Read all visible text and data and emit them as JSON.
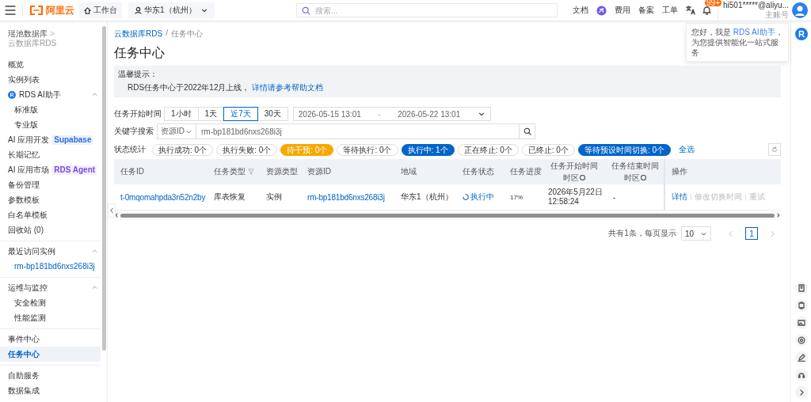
{
  "topbar": {
    "logo": "阿里云",
    "workbench": "工作台",
    "region": "华东1（杭州）",
    "search": {
      "placeholder": "搜索..."
    },
    "items": [
      {
        "kind": "text",
        "label": "文档"
      },
      {
        "kind": "spark"
      },
      {
        "kind": "text",
        "label": "费用"
      },
      {
        "kind": "text",
        "label": "备案"
      },
      {
        "kind": "text",
        "label": "工单"
      },
      {
        "kind": "translate"
      }
    ],
    "notification_badge": "99+",
    "account": {
      "email": "hi501*****@aliyu...",
      "role": "主账号"
    }
  },
  "ai_tip": {
    "prefix": "您好，我是 ",
    "link": "RDS AI助手",
    "suffix": "，为您提供智能化一站式服务"
  },
  "sidebar": {
    "breadcrumb": [
      "瑶池数据库",
      "云数据库RDS"
    ],
    "breadcrumb_separator": ">",
    "sections": [
      {
        "items": [
          {
            "label": "概览",
            "selected": false
          },
          {
            "label": "实例列表",
            "selected": false
          },
          {
            "label": "RDS AI助手",
            "selected": false,
            "kind": "ai",
            "expanded": true,
            "children": [
              {
                "label": "标准版",
                "selected": false
              },
              {
                "label": "专业版",
                "selected": false
              }
            ]
          },
          {
            "label": "AI 应用开发",
            "selected": false,
            "tag": {
              "label": "Supabase",
              "color": "#2f6fe4"
            }
          },
          {
            "label": "长期记忆",
            "selected": false
          },
          {
            "label": "AI 应用市场",
            "selected": false,
            "tag": {
              "label": "RDS Agent",
              "color": "#7a4ce0"
            }
          },
          {
            "label": "备份管理",
            "selected": false
          },
          {
            "label": "参数模板",
            "selected": false
          },
          {
            "label": "白名单模板",
            "selected": false
          },
          {
            "label": "回收站 (0)",
            "selected": false
          }
        ]
      },
      {
        "items": [
          {
            "label": "最近访问实例",
            "selected": false,
            "expanded": true,
            "children": [
              {
                "label": "rm-bp181bd6nxs268i3j",
                "selected": false,
                "kind": "link"
              }
            ]
          }
        ]
      },
      {
        "items": [
          {
            "label": "运维与监控",
            "selected": false,
            "expanded": true,
            "children": [
              {
                "label": "安全检测",
                "selected": false
              },
              {
                "label": "性能监测",
                "selected": false
              }
            ]
          }
        ]
      },
      {
        "items": [
          {
            "label": "事件中心",
            "selected": false
          },
          {
            "label": "任务中心",
            "selected": true
          }
        ]
      },
      {
        "items": [
          {
            "label": "自助服务",
            "selected": false
          },
          {
            "label": "数据集成",
            "selected": false
          }
        ]
      }
    ]
  },
  "main": {
    "breadcrumb": [
      "云数据库RDS",
      "任务中心"
    ],
    "breadcrumb_separator": "/",
    "title": "任务中心",
    "notice": {
      "title": "温馨提示：",
      "text": "RDS任务中心于2022年12月上线，",
      "link": "详情请参考帮助文档"
    },
    "time_filter": {
      "label": "任务开始时间",
      "ranges": [
        {
          "label": "1小时",
          "selected": false
        },
        {
          "label": "1天",
          "selected": false
        },
        {
          "label": "近7天",
          "selected": true
        },
        {
          "label": "30天",
          "selected": false
        }
      ],
      "date_start": "2026-05-15 13:01",
      "date_separator": "-",
      "date_end": "2026-05-22 13:01"
    },
    "keyword": {
      "label": "关键字搜索",
      "field_select": "资源ID",
      "value": "rm-bp181bd6nxs268i3j"
    },
    "status": {
      "label": "状态统计",
      "chips": [
        {
          "label": "执行成功: 0个",
          "kind": "plain"
        },
        {
          "label": "执行失败: 0个",
          "kind": "plain"
        },
        {
          "label": "待干预: 0个",
          "kind": "warning"
        },
        {
          "label": "等待执行: 0个",
          "kind": "plain"
        },
        {
          "label": "执行中: 1个",
          "kind": "primary"
        },
        {
          "label": "正在终止: 0个",
          "kind": "plain"
        },
        {
          "label": "已终止: 0个",
          "kind": "plain"
        },
        {
          "label": "等待预设时间切换: 0个",
          "kind": "primary"
        }
      ],
      "select_all": "全选"
    },
    "table": {
      "columns": [
        {
          "label": "任务ID"
        },
        {
          "label": "任务类型",
          "filter": true
        },
        {
          "label": "资源类型"
        },
        {
          "label": "资源ID"
        },
        {
          "label": "地域"
        },
        {
          "label": "任务状态"
        },
        {
          "label": "任务进度"
        },
        {
          "label": "任务开始时间",
          "sublabel": "时区",
          "help": true
        },
        {
          "label": "任务结束时间",
          "sublabel": "时区",
          "help": true
        },
        {
          "label": "操作"
        }
      ],
      "rows": [
        {
          "task_id": "t-0mqomahpda3n52n2by",
          "task_type": "库表恢复",
          "resource_type": "实例",
          "resource_id": "rm-bp181bd6nxs268i3j",
          "region": "华东1（杭州）",
          "status": "执行中",
          "progress": "17%",
          "start_time": [
            "2026年5月22日",
            "12:58:24"
          ],
          "end_time": "-",
          "actions": [
            {
              "label": "详情",
              "disabled": false
            },
            {
              "label": "修改切换时间",
              "disabled": true
            },
            {
              "label": "重试",
              "disabled": true
            }
          ]
        }
      ]
    },
    "pagination": {
      "summary": "共有1条，每页显示",
      "page_size": "10",
      "pages": [
        {
          "label": "1",
          "selected": true
        }
      ]
    }
  }
}
